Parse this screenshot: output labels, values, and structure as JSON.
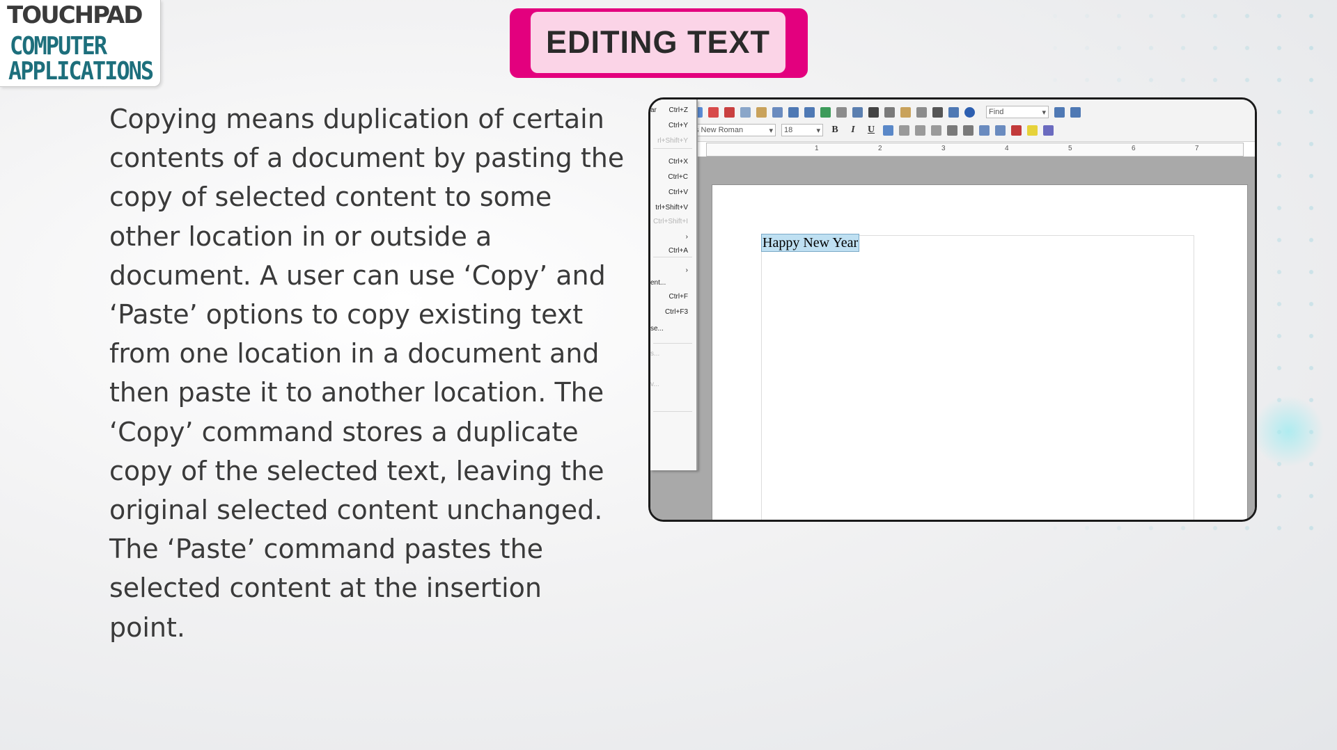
{
  "logo": {
    "brand": "TOUCHPAD",
    "line1": "COMPUTER",
    "line2": "APPLICATIONS"
  },
  "title": "EDITING TEXT",
  "body_text": "Copying means duplication of certain contents of a document by pasting the copy of selected content to some other location in or outside a document. A user can use ‘Copy’ and ‘Paste’ options to copy existing text from one location in a document and then paste it to another location. The ‘Copy’ command stores a duplicate copy of the selected text, leaving the original selected content unchanged. The ‘Paste’ command pastes the selected content at the insertion point.",
  "writer": {
    "find_placeholder": "Find",
    "font_name": "s New Roman",
    "font_size": "18",
    "bold": "B",
    "italic": "I",
    "underline": "U",
    "ruler_numbers": [
      "1",
      "2",
      "3",
      "4",
      "5",
      "6",
      "7"
    ],
    "document_text": "Happy New Year",
    "menu_items": [
      {
        "label": "ar",
        "shortcut": "Ctrl+Z",
        "dim": false
      },
      {
        "label": "",
        "shortcut": "Ctrl+Y",
        "dim": false
      },
      {
        "label": "",
        "shortcut": "rl+Shift+Y",
        "dim": true
      },
      {
        "label": "",
        "shortcut": "Ctrl+X",
        "dim": false
      },
      {
        "label": "",
        "shortcut": "Ctrl+C",
        "dim": false
      },
      {
        "label": "",
        "shortcut": "Ctrl+V",
        "dim": false
      },
      {
        "label": "",
        "shortcut": "trl+Shift+V",
        "dim": false
      },
      {
        "label": "",
        "shortcut": "Ctrl+Shift+I",
        "dim": true
      },
      {
        "label": "",
        "shortcut": "›",
        "dim": false
      },
      {
        "label": "",
        "shortcut": "Ctrl+A",
        "dim": false
      },
      {
        "label": "",
        "shortcut": "›",
        "dim": false
      },
      {
        "label": "ent...",
        "shortcut": "",
        "dim": false
      },
      {
        "label": "",
        "shortcut": "Ctrl+F",
        "dim": false
      },
      {
        "label": "",
        "shortcut": "Ctrl+F3",
        "dim": false
      },
      {
        "label": "se...",
        "shortcut": "",
        "dim": false
      },
      {
        "label": "s...",
        "shortcut": "",
        "dim": true
      },
      {
        "label": "v...",
        "shortcut": "",
        "dim": true
      }
    ]
  },
  "colors": {
    "title_border": "#e3007e",
    "title_fill": "#fbd4e7",
    "logo_teal": "#1d6f7c",
    "selection": "#bfe0f2"
  }
}
